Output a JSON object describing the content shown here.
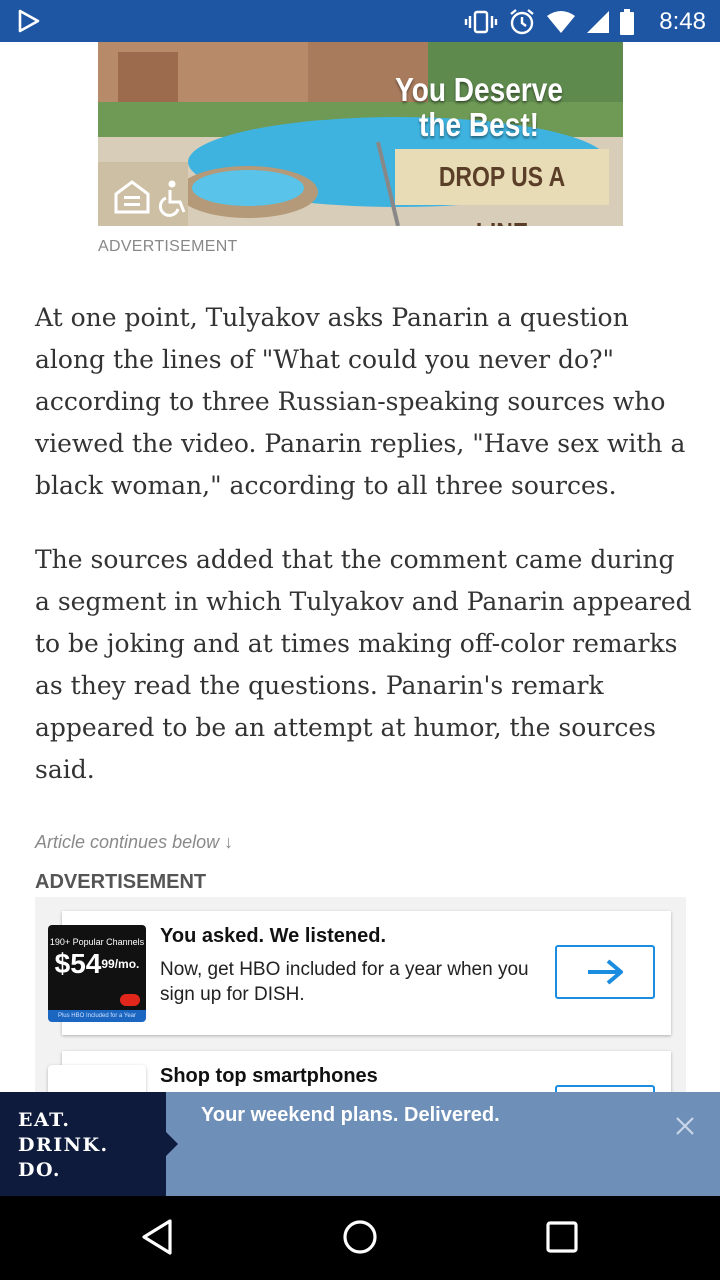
{
  "status_bar": {
    "time": "8:48",
    "icons": [
      "play-icon",
      "vibrate-icon",
      "alarm-icon",
      "wifi-icon",
      "signal-icon",
      "battery-icon"
    ]
  },
  "top_ad": {
    "headline": "You Deserve the Best!",
    "cta": "DROP US A LINE",
    "label": "ADVERTISEMENT"
  },
  "article": {
    "paragraphs": [
      "At one point, Tulyakov asks Panarin a question along the lines of \"What could you never do?\" according to three Russian-speaking sources who viewed the video. Panarin replies, \"Have sex with a black woman,\" according to all three sources.",
      "The sources added that the comment came during a segment in which Tulyakov and Panarin appeared to be joking and at times making off-color remarks as they read the questions. Panarin's remark appeared to be an attempt at humor, the sources said."
    ],
    "continues": "Article continues below ↓"
  },
  "ad_block": {
    "label": "ADVERTISEMENT",
    "cards": [
      {
        "title": "You asked. We listened.",
        "body": "Now, get HBO included for a year when you sign up for DISH.",
        "badge_top": "190+ Popular Channels",
        "badge_price": "$54",
        "badge_cents": "99",
        "badge_per": "/mo.",
        "badge_foot": "Plus HBO Included for a Year"
      },
      {
        "title": "Shop top smartphones"
      }
    ]
  },
  "banner": {
    "logo_line1": "EAT. DRINK.",
    "logo_line2": "DO.",
    "text": "Your weekend plans. Delivered."
  },
  "colors": {
    "status_bar": "#1f56a4",
    "banner": "#6e8fb8",
    "banner_logo": "#0f1b3d",
    "cta_border": "#1a8de0"
  }
}
